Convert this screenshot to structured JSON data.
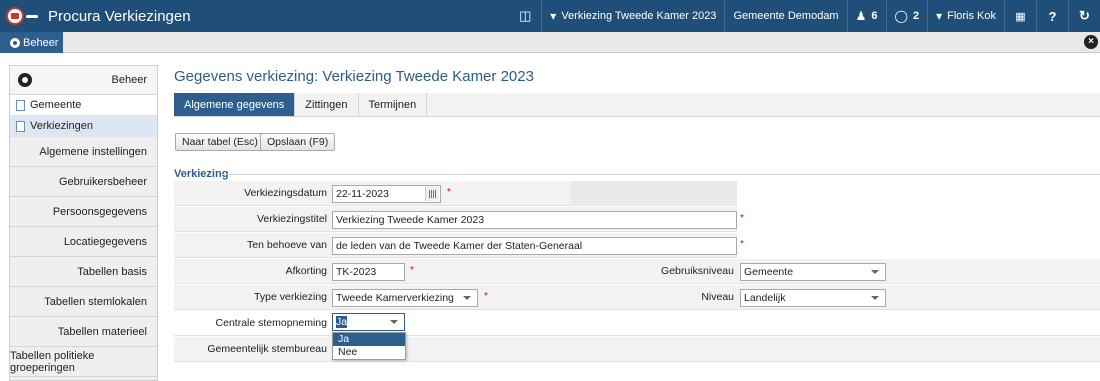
{
  "topbar": {
    "app_title": "Procura Verkiezingen",
    "election_selector": "Verkiezing Tweede Kamer 2023",
    "municipality": "Gemeente Demodam",
    "users_count": "6",
    "messages_count": "2",
    "user_name": "Floris Kok",
    "help_label": "?",
    "brand_color": "#1f4e79"
  },
  "secondbar": {
    "active_tab": "Beheer"
  },
  "sidebar": {
    "header": "Beheer",
    "sub_items": [
      {
        "label": "Gemeente"
      },
      {
        "label": "Verkiezingen"
      }
    ],
    "items": [
      {
        "label": "Algemene instellingen"
      },
      {
        "label": "Gebruikersbeheer"
      },
      {
        "label": "Persoonsgegevens"
      },
      {
        "label": "Locatiegegevens"
      },
      {
        "label": "Tabellen basis"
      },
      {
        "label": "Tabellen stemlokalen"
      },
      {
        "label": "Tabellen materieel"
      },
      {
        "label": "Tabellen politieke groeperingen"
      }
    ]
  },
  "main": {
    "title": "Gegevens verkiezing: Verkiezing Tweede Kamer 2023",
    "tabs": [
      {
        "label": "Algemene gegevens"
      },
      {
        "label": "Zittingen"
      },
      {
        "label": "Termijnen"
      }
    ],
    "buttons": {
      "back": "Naar tabel (Esc)",
      "save": "Opslaan (F9)"
    },
    "section_title": "Verkiezing",
    "form": {
      "date_label": "Verkiezingsdatum",
      "date_value": "22-11-2023",
      "title_label": "Verkiezingstitel",
      "title_value": "Verkiezing Tweede Kamer 2023",
      "behalf_label": "Ten behoeve van",
      "behalf_value": "de leden van de Tweede Kamer der Staten-Generaal",
      "abbr_label": "Afkorting",
      "abbr_value": "TK-2023",
      "usage_label": "Gebruiksniveau",
      "usage_value": "Gemeente",
      "type_label": "Type verkiezing",
      "type_value": "Tweede Kamerverkiezing",
      "level_label": "Niveau",
      "level_value": "Landelijk",
      "central_label": "Centrale stemopneming",
      "central_value": "Ja",
      "office_label": "Gemeentelijk stembureau",
      "required_mark": "*"
    },
    "dropdown_options": [
      "Ja",
      "Nee"
    ]
  }
}
